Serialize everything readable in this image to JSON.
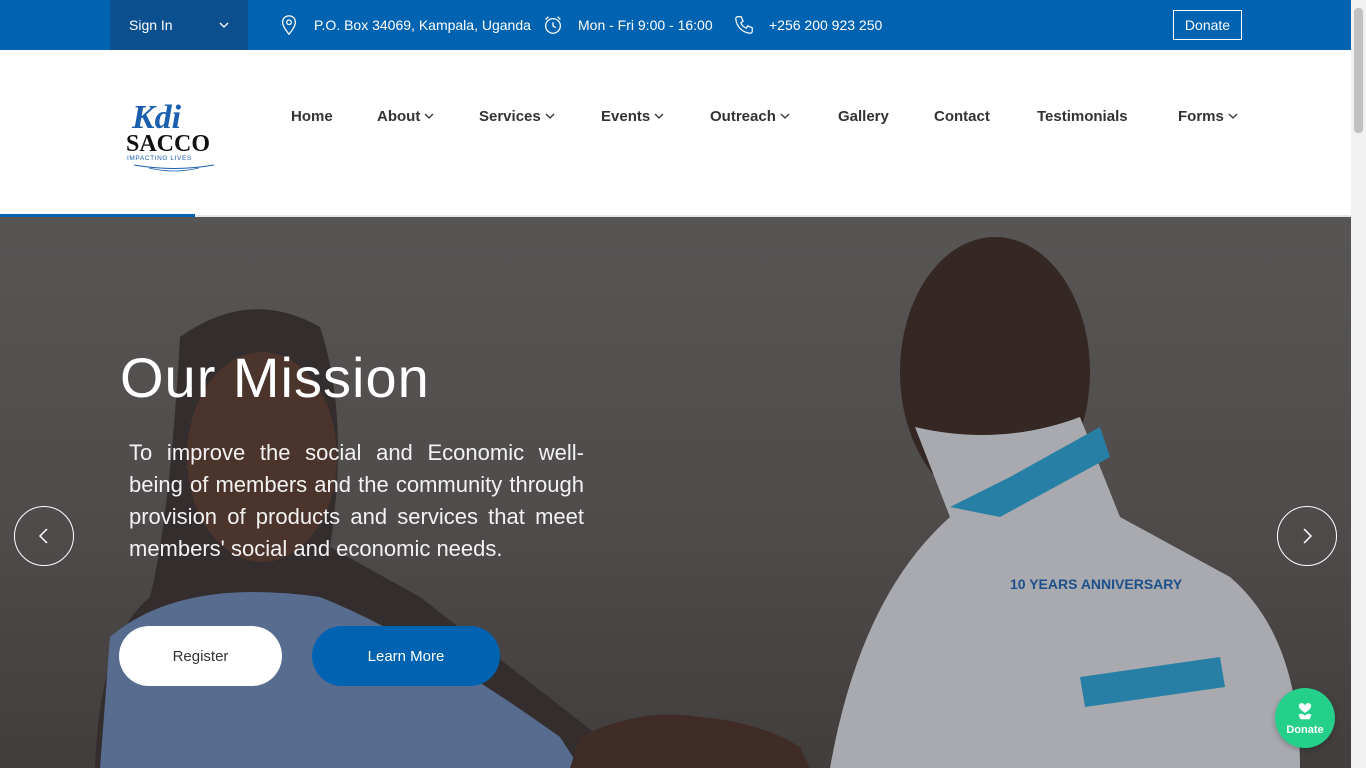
{
  "topbar": {
    "signin_label": "Sign In",
    "address": "P.O. Box 34069, Kampala, Uganda",
    "hours": "Mon - Fri 9:00 - 16:00",
    "phone": "+256 200 923 250",
    "donate_label": "Donate"
  },
  "logo": {
    "mark": "Kdi",
    "name": "SACCO",
    "tagline": "IMPACTING LIVES"
  },
  "nav": {
    "items": [
      {
        "label": "Home"
      },
      {
        "label": "About"
      },
      {
        "label": "Services"
      },
      {
        "label": "Events"
      },
      {
        "label": "Outreach"
      },
      {
        "label": "Gallery"
      },
      {
        "label": "Contact"
      },
      {
        "label": "Testimonials"
      },
      {
        "label": "Forms"
      }
    ]
  },
  "hero": {
    "title": "Our Mission",
    "text": "To improve the social and Economic well-being of members and the community through provision of products and services that meet members' social and economic needs.",
    "register_label": "Register",
    "learn_label": "Learn More",
    "shirt_badge": "10 YEARS ANNIVERSARY"
  },
  "floating": {
    "donate_label": "Donate"
  },
  "colors": {
    "primary": "#0063b1",
    "signin_bg": "#0b4f8f",
    "donate_float": "#25d08a"
  },
  "icons": [
    "chevron-down-icon",
    "location-pin-icon",
    "clock-icon",
    "phone-icon",
    "arrow-left-icon",
    "arrow-right-icon",
    "heart-hand-icon"
  ]
}
